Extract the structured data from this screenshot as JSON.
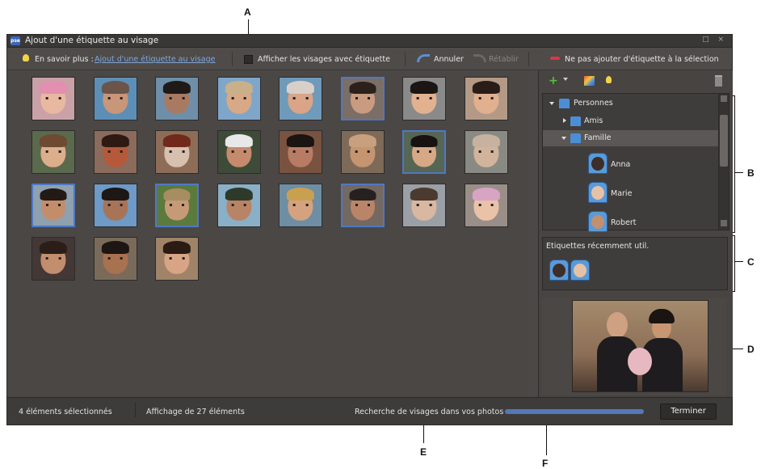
{
  "callouts": {
    "a": "A",
    "b": "B",
    "c": "C",
    "d": "D",
    "e": "E",
    "f": "F"
  },
  "window": {
    "title": "Ajout d'une étiquette au visage",
    "logo": "pse",
    "controls": "□ ×"
  },
  "toolbar": {
    "learn_more_label": "En savoir plus :",
    "learn_more_link": "Ajout d'une étiquette au visage",
    "show_tagged_label": "Afficher les visages avec étiquette",
    "undo_label": "Annuler",
    "redo_label": "Rétablir",
    "no_tag_label": "Ne pas ajouter d'étiquette à la sélection"
  },
  "faces": [
    {
      "skin": "#e8b8a0",
      "hair": "#e28fb0",
      "bg": "#caa1a7",
      "selected": false
    },
    {
      "skin": "#c9967a",
      "hair": "#6b5449",
      "bg": "#5d8fb6",
      "selected": false
    },
    {
      "skin": "#a97a62",
      "hair": "#1f1a18",
      "bg": "#6f8fa8",
      "selected": false
    },
    {
      "skin": "#d7a987",
      "hair": "#c8b08a",
      "bg": "#7fa6c8",
      "selected": false
    },
    {
      "skin": "#d9a488",
      "hair": "#d8d0c8",
      "bg": "#6f9ab9",
      "selected": false
    },
    {
      "skin": "#c99b80",
      "hair": "#2a201c",
      "bg": "#7b6e66",
      "selected": true
    },
    {
      "skin": "#e2b190",
      "hair": "#1b1514",
      "bg": "#8a8a8a",
      "selected": false
    },
    {
      "skin": "#e0b08f",
      "hair": "#2a1d18",
      "bg": "#b49a86",
      "selected": false
    },
    {
      "skin": "#dcae8c",
      "hair": "#6e4a33",
      "bg": "#5b6a4c",
      "selected": false
    },
    {
      "skin": "#b6593a",
      "hair": "#2e1a12",
      "bg": "#8a6b5c",
      "selected": false
    },
    {
      "skin": "#d8c0ae",
      "hair": "#6f2a1c",
      "bg": "#8e6d58",
      "selected": false
    },
    {
      "skin": "#c68a6c",
      "hair": "#e8e8e8",
      "bg": "#3e4b38",
      "selected": false
    },
    {
      "skin": "#b87c64",
      "hair": "#1a1412",
      "bg": "#7a5240",
      "selected": false
    },
    {
      "skin": "#c4956f",
      "hair": "#c9a07e",
      "bg": "#7e6a58",
      "selected": false
    },
    {
      "skin": "#d6a885",
      "hair": "#181210",
      "bg": "#556655",
      "selected": true
    },
    {
      "skin": "#d2b49c",
      "hair": "#c7b29f",
      "bg": "#8a8a84",
      "selected": false
    },
    {
      "skin": "#c48d6a",
      "hair": "#231a16",
      "bg": "#8fa0ae",
      "selected": true
    },
    {
      "skin": "#a87458",
      "hair": "#1d1715",
      "bg": "#6d9ac6",
      "selected": false
    },
    {
      "skin": "#c79a76",
      "hair": "#a68e62",
      "bg": "#5b7a3e",
      "selected": true
    },
    {
      "skin": "#b98365",
      "hair": "#2d3a2a",
      "bg": "#8ab0c8",
      "selected": false
    },
    {
      "skin": "#d5a27f",
      "hair": "#c8a050",
      "bg": "#6e8ea4",
      "selected": false
    },
    {
      "skin": "#b98467",
      "hair": "#262021",
      "bg": "#746860",
      "selected": true
    },
    {
      "skin": "#d9b7a0",
      "hair": "#4a3a30",
      "bg": "#9aa0a6",
      "selected": false
    },
    {
      "skin": "#e9c2a8",
      "hair": "#d8a4c4",
      "bg": "#9a8f88",
      "selected": false
    },
    {
      "skin": "#c28e6e",
      "hair": "#2b1e18",
      "bg": "#433836",
      "selected": false
    },
    {
      "skin": "#a8714f",
      "hair": "#1d1612",
      "bg": "#7a6a5a",
      "selected": false
    },
    {
      "skin": "#d7a585",
      "hair": "#2a1b14",
      "bg": "#a08368",
      "selected": false
    }
  ],
  "right_panel": {
    "people_label": "Personnes",
    "friends_label": "Amis",
    "family_label": "Famille",
    "people": [
      "Anna",
      "Marie",
      "Robert"
    ],
    "recent_label": "Etiquettes récemment util."
  },
  "status": {
    "selected_count": "4 éléments sélectionnés",
    "showing_count": "Affichage de 27 éléments",
    "searching_label": "Recherche de visages dans vos photos",
    "done_label": "Terminer",
    "progress": 1.0
  },
  "colors": {
    "accent": "#4f78c4",
    "link": "#7fa6d9",
    "panel_bg": "#4b4846"
  }
}
